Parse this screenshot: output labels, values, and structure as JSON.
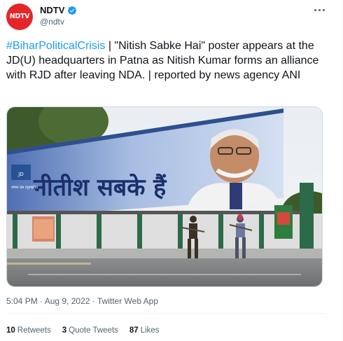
{
  "author": {
    "avatar_text": "NDTV",
    "name": "NDTV",
    "handle": "@ndtv",
    "verified": true
  },
  "tweet": {
    "hashtag": "#BiharPoliticalCrisis",
    "body": " | \"Nitish Sabke Hai\" poster appears at the JD(U) headquarters in Patna as Nitish Kumar forms an alliance with RJD after leaving NDA. | reported by news agency ANI"
  },
  "media": {
    "poster_text": "नीतीश सबके हैं",
    "poster_logo_text": "जनता दल (यूनाइटेड)"
  },
  "meta": {
    "timestamp": "5:04 PM · Aug 9, 2022 · Twitter Web App"
  },
  "stats": {
    "retweets_count": "10",
    "retweets_label": "Retweets",
    "quote_count": "3",
    "quote_label": "Quote Tweets",
    "likes_count": "87",
    "likes_label": "Likes"
  },
  "colors": {
    "accent": "#1d9bf0",
    "brand": "#e4262b",
    "text": "#0f1419",
    "muted": "#536471"
  }
}
